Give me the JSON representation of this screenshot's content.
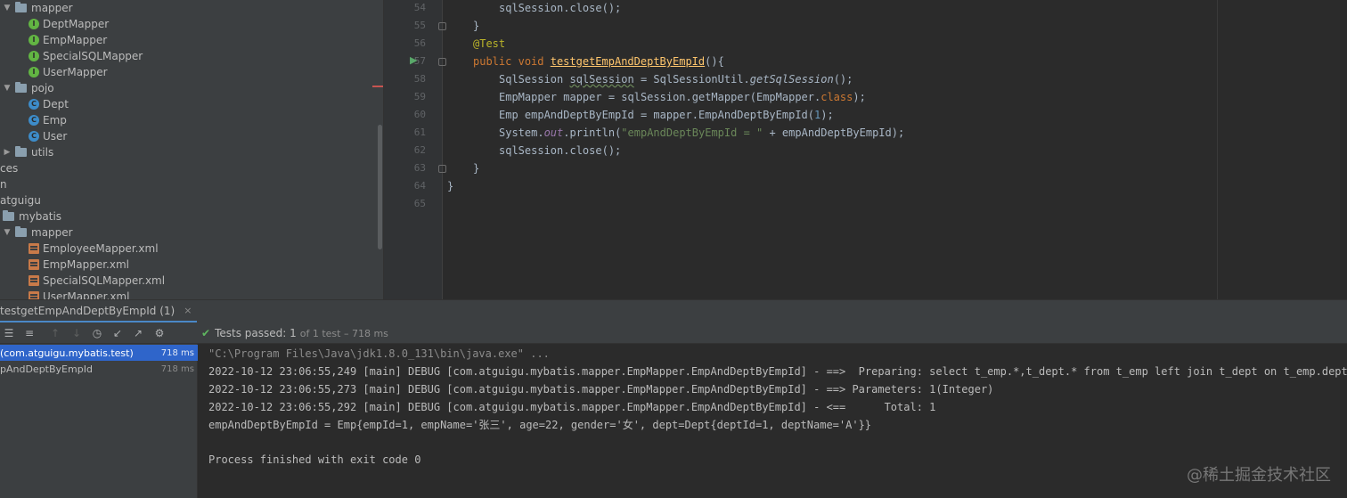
{
  "project_tree": {
    "items": [
      {
        "label": "mapper",
        "kind": "folder",
        "arrow": "open"
      },
      {
        "label": "DeptMapper",
        "kind": "interface"
      },
      {
        "label": "EmpMapper",
        "kind": "interface"
      },
      {
        "label": "SpecialSQLMapper",
        "kind": "interface"
      },
      {
        "label": "UserMapper",
        "kind": "interface"
      },
      {
        "label": "pojo",
        "kind": "folder",
        "arrow": "open"
      },
      {
        "label": "Dept",
        "kind": "class"
      },
      {
        "label": "Emp",
        "kind": "class"
      },
      {
        "label": "User",
        "kind": "class"
      },
      {
        "label": "utils",
        "kind": "folder",
        "arrow": "closed"
      },
      {
        "label": "ces",
        "kind": "text"
      },
      {
        "label": "n",
        "kind": "text"
      },
      {
        "label": "atguigu",
        "kind": "text"
      },
      {
        "label": "mybatis",
        "kind": "folder"
      },
      {
        "label": "mapper",
        "kind": "folder",
        "arrow": "open"
      },
      {
        "label": "EmployeeMapper.xml",
        "kind": "xml"
      },
      {
        "label": "EmpMapper.xml",
        "kind": "xml"
      },
      {
        "label": "SpecialSQLMapper.xml",
        "kind": "xml"
      },
      {
        "label": "UserMapper.xml",
        "kind": "xml"
      }
    ]
  },
  "editor": {
    "line_numbers": [
      "54",
      "55",
      "56",
      "57",
      "58",
      "59",
      "60",
      "61",
      "62",
      "63",
      "64",
      "65"
    ],
    "code": {
      "l54_a": "sqlSession.close();",
      "l55_a": "}",
      "l56_a": "@Test",
      "l57_kw1": "public",
      "l57_kw2": "void",
      "l57_fn": "testgetEmpAndDeptByEmpId",
      "l57_rest": "(){",
      "l58_a": "SqlSession ",
      "l58_b": "sqlSession",
      "l58_c": " = SqlSessionUtil.",
      "l58_d": "getSqlSession",
      "l58_e": "();",
      "l59_a": "EmpMapper mapper = sqlSession.getMapper(EmpMapper.",
      "l59_b": "class",
      "l59_c": ");",
      "l60_a": "Emp empAndDeptByEmpId = mapper.EmpAndDeptByEmpId(",
      "l60_b": "1",
      "l60_c": ");",
      "l61_a": "System.",
      "l61_b": "out",
      "l61_c": ".println(",
      "l61_d": "\"empAndDeptByEmpId = \"",
      "l61_e": " + empAndDeptByEmpId);",
      "l62_a": "sqlSession.close();",
      "l63_a": "}",
      "l64_a": "}"
    }
  },
  "run_panel": {
    "tab_label": "testgetEmpAndDeptByEmpId (1)",
    "tab_close": "×",
    "status_check": "✔",
    "status_label": "Tests passed: 1",
    "status_sub": "of 1 test – 718 ms",
    "tests": [
      {
        "label": "(com.atguigu.mybatis.test)",
        "time": "718 ms",
        "selected": true
      },
      {
        "label": "pAndDeptByEmpId",
        "time": "718 ms",
        "selected": false
      }
    ]
  },
  "console": {
    "lines": [
      "\"C:\\Program Files\\Java\\jdk1.8.0_131\\bin\\java.exe\" ...",
      "2022-10-12 23:06:55,249 [main] DEBUG [com.atguigu.mybatis.mapper.EmpMapper.EmpAndDeptByEmpId] - ==>  Preparing: select t_emp.*,t_dept.* from t_emp left join t_dept on t_emp.dept_",
      "2022-10-12 23:06:55,273 [main] DEBUG [com.atguigu.mybatis.mapper.EmpMapper.EmpAndDeptByEmpId] - ==> Parameters: 1(Integer)",
      "2022-10-12 23:06:55,292 [main] DEBUG [com.atguigu.mybatis.mapper.EmpMapper.EmpAndDeptByEmpId] - <==      Total: 1",
      "empAndDeptByEmpId = Emp{empId=1, empName='张三', age=22, gender='女', dept=Dept{deptId=1, deptName='A'}}",
      "",
      "Process finished with exit code 0"
    ]
  },
  "watermark": "@稀土掘金技术社区",
  "colors": {
    "accent": "#2f65ca",
    "pass": "#5fb760",
    "keyword": "#cc7832",
    "function": "#ffc66d"
  }
}
